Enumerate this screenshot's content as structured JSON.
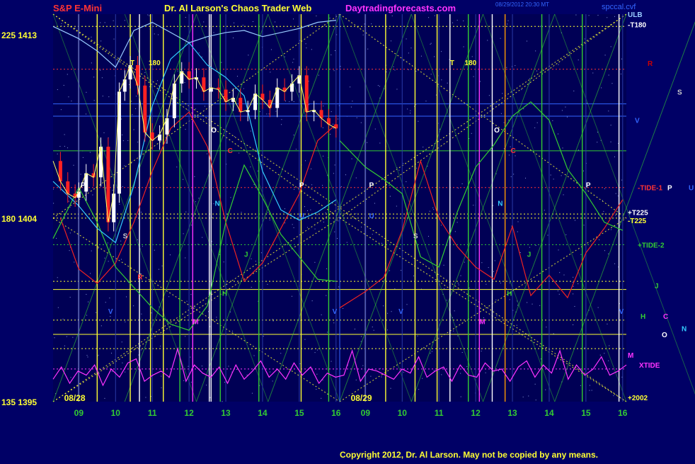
{
  "header": {
    "instrument": "S&P E-Mini",
    "title": "Dr. Al Larson's Chaos Trader Web",
    "site": "Daytradingforecasts.com",
    "timestamp": "08/29/2012 20:30 MT",
    "right_tag": "spccal.cvf"
  },
  "copyright": "Copyright 2012, Dr. Al Larson. May not be copied by any means.",
  "colors": {
    "background": "#000066",
    "plot_bg": "#000055",
    "price_up": "#ffffff",
    "price_down": "#ff2222",
    "grid_yellow": "#ffff33",
    "green_line": "#33cc33",
    "red_line": "#ee2222",
    "cyan_line": "#33ccff",
    "xtide": "#ff33ff"
  },
  "chart_data": {
    "type": "line",
    "title": "S&P E-Mini",
    "y_ticks": [
      {
        "label": "225 1413",
        "price": 1413
      },
      {
        "label": "180 1404",
        "price": 1404
      },
      {
        "label": "135 1395",
        "price": 1395
      }
    ],
    "ylim": [
      1395,
      1414
    ],
    "date_labels": [
      "08/28",
      "08/29"
    ],
    "x_ticks_day1": [
      "09",
      "10",
      "11",
      "12",
      "13",
      "14",
      "15",
      "16"
    ],
    "x_ticks_day2": [
      "09",
      "10",
      "11",
      "12",
      "13",
      "14",
      "15",
      "16"
    ],
    "x_range_hours": [
      8.3,
      16.1
    ],
    "price_series": {
      "name": "S&P E-Mini",
      "x": [
        8.3,
        8.5,
        8.7,
        8.9,
        9.0,
        9.2,
        9.4,
        9.6,
        9.8,
        9.95,
        10.1,
        10.25,
        10.4,
        10.6,
        10.8,
        11.0,
        11.2,
        11.4,
        11.6,
        11.8,
        12.0,
        12.2,
        12.4,
        12.6,
        12.8,
        13.0,
        13.2,
        13.4,
        13.6,
        13.8,
        14.0,
        14.2,
        14.4,
        14.6,
        14.8,
        15.0,
        15.2,
        15.4,
        15.6,
        15.8,
        16.0
      ],
      "y": [
        1406.8,
        1405.8,
        1405.2,
        1405.0,
        1405.3,
        1406.2,
        1406.0,
        1407.5,
        1403.8,
        1405.2,
        1410.2,
        1410.8,
        1411.5,
        1410.5,
        1408.2,
        1407.8,
        1408.1,
        1408.9,
        1410.6,
        1411.2,
        1410.8,
        1410.9,
        1410.2,
        1410.4,
        1410.3,
        1409.7,
        1409.9,
        1409.2,
        1409.3,
        1410.1,
        1409.8,
        1409.4,
        1410.4,
        1410.2,
        1410.6,
        1411.0,
        1409.2,
        1409.3,
        1408.9,
        1408.6,
        1408.4
      ]
    },
    "cycle_series": [
      {
        "name": "red",
        "color": "#ee2222",
        "x1": [
          8.5,
          9.0,
          9.5,
          10.0,
          10.5,
          11.0,
          11.5,
          12.0,
          12.5,
          13.0,
          13.5,
          14.0,
          14.5,
          15.0,
          15.5,
          16.0
        ],
        "y1": [
          1404.0,
          1401.5,
          1400.8,
          1401.8,
          1403.8,
          1406.3,
          1408.4,
          1409.2,
          1407.5,
          1403.8,
          1400.9,
          1401.8,
          1403.5,
          1405.2,
          1407.8,
          1408.6
        ],
        "x2": [
          8.3,
          9.0,
          9.5,
          10.0,
          10.5,
          11.0,
          11.5,
          12.0,
          12.5,
          13.0,
          13.5,
          14.0,
          14.5,
          15.0,
          15.5,
          16.0
        ],
        "y2": [
          1399.6,
          1400.4,
          1401.1,
          1403.4,
          1406.8,
          1404.0,
          1402.6,
          1401.6,
          1401.0,
          1403.6,
          1400.2,
          1401.2,
          1400.1,
          1402.3,
          1403.5,
          1404.9
        ]
      },
      {
        "name": "green",
        "color": "#33cc33",
        "x1": [
          8.3,
          9.0,
          9.5,
          10.0,
          10.5,
          11.0,
          11.5,
          12.0,
          12.5,
          13.0,
          13.5,
          14.0,
          14.5,
          15.0,
          15.5,
          16.0
        ],
        "y1": [
          1403.0,
          1405.5,
          1403.8,
          1401.6,
          1400.6,
          1399.6,
          1398.8,
          1398.5,
          1399.7,
          1403.8,
          1406.6,
          1405.0,
          1403.2,
          1402.1,
          1401.0,
          1400.9
        ],
        "x2": [
          8.3,
          9.0,
          9.5,
          10.0,
          10.5,
          11.0,
          11.5,
          12.0,
          12.5,
          13.0,
          13.5,
          14.0,
          14.5,
          15.0,
          15.5,
          16.0
        ],
        "y2": [
          1407.8,
          1406.5,
          1405.9,
          1405.2,
          1402.1,
          1401.6,
          1404.3,
          1406.5,
          1407.6,
          1409.0,
          1409.7,
          1408.8,
          1406.4,
          1405.2,
          1403.8,
          1403.4
        ]
      },
      {
        "name": "cyan",
        "color": "#33ccff",
        "x1": [
          8.3,
          9.0,
          9.5,
          10.0,
          10.5,
          11.0,
          11.5,
          12.0,
          12.5,
          13.0,
          13.5,
          14.0,
          14.5,
          15.0,
          15.5,
          16.0
        ],
        "y1": [
          1405.8,
          1404.6,
          1403.5,
          1402.8,
          1405.6,
          1409.5,
          1411.8,
          1412.6,
          1411.5,
          1410.9,
          1410.0,
          1406.3,
          1404.4,
          1403.9,
          1404.3,
          1404.9
        ],
        "x2": [],
        "y2": []
      },
      {
        "name": "lightblue",
        "color": "#99ccff",
        "x1": [
          8.3,
          9.0,
          9.5,
          10.0,
          10.5,
          11.0,
          11.5,
          12.0,
          12.5,
          13.0,
          13.5,
          14.0,
          14.5,
          15.0,
          15.5,
          16.0
        ],
        "y1": [
          1413.4,
          1412.8,
          1412.2,
          1411.4,
          1413.2,
          1413.6,
          1413.1,
          1412.6,
          1412.9,
          1413.1,
          1413.2,
          1412.9,
          1413.1,
          1413.3,
          1413.6,
          1413.7
        ],
        "x2": [],
        "y2": []
      }
    ],
    "vertical_lines": [
      {
        "h": 9.0,
        "color": "#ffffff"
      },
      {
        "h": 9.5,
        "color": "#ffff33"
      },
      {
        "h": 10.4,
        "color": "#ffff33"
      },
      {
        "h": 10.65,
        "color": "#ffffff"
      },
      {
        "h": 10.95,
        "color": "#ffff33"
      },
      {
        "h": 11.3,
        "color": "#ffff33"
      },
      {
        "h": 11.75,
        "color": "#33cc33"
      },
      {
        "h": 12.1,
        "color": "#ff33ff"
      },
      {
        "h": 12.55,
        "color": "#ffffff"
      },
      {
        "h": 12.6,
        "color": "#ffffff"
      },
      {
        "h": 12.85,
        "color": "#33cc33"
      },
      {
        "h": 13.9,
        "color": "#33cc33"
      },
      {
        "h": 15.05,
        "color": "#ffff33"
      },
      {
        "h": 15.8,
        "color": "#33cc33"
      }
    ],
    "vertical_lines_day2": [
      {
        "h": 9.0,
        "color": "#ffffff"
      },
      {
        "h": 9.55,
        "color": "#ffff33"
      },
      {
        "h": 10.35,
        "color": "#ffff33"
      },
      {
        "h": 10.95,
        "color": "#ffff33"
      },
      {
        "h": 11.3,
        "color": "#ffffff"
      },
      {
        "h": 11.8,
        "color": "#33cc33"
      },
      {
        "h": 12.1,
        "color": "#ff33ff"
      },
      {
        "h": 12.45,
        "color": "#ffffff"
      },
      {
        "h": 12.8,
        "color": "#ff9900"
      },
      {
        "h": 13.8,
        "color": "#33cc33"
      },
      {
        "h": 14.9,
        "color": "#33cc33"
      },
      {
        "h": 15.9,
        "color": "#ffffff"
      }
    ],
    "annotations": [
      {
        "t": "T",
        "day": 1,
        "h": 10.4,
        "p": 1411.5,
        "c": "#ffff33"
      },
      {
        "t": "180",
        "day": 1,
        "h": 10.9,
        "p": 1411.5,
        "c": "#ffff33"
      },
      {
        "t": "T",
        "day": 2,
        "h": 11.3,
        "p": 1411.5,
        "c": "#ffff33"
      },
      {
        "t": "180",
        "day": 2,
        "h": 11.7,
        "p": 1411.5,
        "c": "#ffff33"
      },
      {
        "t": "P",
        "day": 1,
        "h": 9.05,
        "p": 1405.5,
        "c": "#ffffff"
      },
      {
        "t": "P",
        "day": 1,
        "h": 15.0,
        "p": 1405.5,
        "c": "#ffffff"
      },
      {
        "t": "P",
        "day": 2,
        "h": 9.1,
        "p": 1405.5,
        "c": "#ffffff"
      },
      {
        "t": "P",
        "day": 2,
        "h": 15.0,
        "p": 1405.5,
        "c": "#ffffff"
      },
      {
        "t": "O",
        "day": 1,
        "h": 12.6,
        "p": 1408.2,
        "c": "#ffffff"
      },
      {
        "t": "O",
        "day": 2,
        "h": 12.5,
        "p": 1408.2,
        "c": "#ffffff"
      },
      {
        "t": "C",
        "day": 1,
        "h": 13.05,
        "p": 1407.2,
        "c": "#ff3333"
      },
      {
        "t": "C",
        "day": 2,
        "h": 12.95,
        "p": 1407.2,
        "c": "#ff3333"
      },
      {
        "t": "N",
        "day": 1,
        "h": 12.7,
        "p": 1404.6,
        "c": "#33ccff"
      },
      {
        "t": "N",
        "day": 2,
        "h": 12.6,
        "p": 1404.6,
        "c": "#33ccff"
      },
      {
        "t": "U",
        "day": 1,
        "h": 15.0,
        "p": 1404.0,
        "c": "#3366ff"
      },
      {
        "t": "U",
        "day": 2,
        "h": 9.1,
        "p": 1404.0,
        "c": "#3366ff"
      },
      {
        "t": "S",
        "day": 1,
        "h": 10.2,
        "p": 1403.0,
        "c": "#cccccc"
      },
      {
        "t": "S",
        "day": 2,
        "h": 10.3,
        "p": 1403.0,
        "c": "#cccccc"
      },
      {
        "t": "J",
        "day": 1,
        "h": 13.5,
        "p": 1402.1,
        "c": "#33cc33"
      },
      {
        "t": "J",
        "day": 2,
        "h": 13.4,
        "p": 1402.1,
        "c": "#33cc33"
      },
      {
        "t": "R",
        "day": 1,
        "h": 10.6,
        "p": 1401.0,
        "c": "#ff3333"
      },
      {
        "t": "H",
        "day": 1,
        "h": 12.9,
        "p": 1400.2,
        "c": "#33cc33"
      },
      {
        "t": "H",
        "day": 2,
        "h": 12.85,
        "p": 1400.2,
        "c": "#33cc33"
      },
      {
        "t": "M",
        "day": 1,
        "h": 12.1,
        "p": 1398.8,
        "c": "#ff33ff"
      },
      {
        "t": "M",
        "day": 2,
        "h": 12.1,
        "p": 1398.8,
        "c": "#ff33ff"
      },
      {
        "t": "V",
        "day": 1,
        "h": 9.8,
        "p": 1399.3,
        "c": "#3366ff"
      },
      {
        "t": "V",
        "day": 1,
        "h": 15.9,
        "p": 1399.3,
        "c": "#3366ff"
      },
      {
        "t": "V",
        "day": 2,
        "h": 9.9,
        "p": 1399.3,
        "c": "#3366ff"
      },
      {
        "t": "V",
        "day": 2,
        "h": 15.9,
        "p": 1399.3,
        "c": "#3366ff"
      }
    ],
    "right_labels": [
      {
        "t": "ULB",
        "p": 1414.0,
        "c": "#99ccff",
        "dx": 0
      },
      {
        "t": "-T180",
        "p": 1413.5,
        "c": "#ffffff",
        "dx": 0
      },
      {
        "t": "R",
        "p": 1411.6,
        "c": "#cc0000",
        "dx": 28
      },
      {
        "t": "S",
        "p": 1410.2,
        "c": "#cccccc",
        "dx": 70
      },
      {
        "t": "V",
        "p": 1408.8,
        "c": "#3366ff",
        "dx": 10
      },
      {
        "t": "-TIDE-1",
        "p": 1405.5,
        "c": "#ff3333",
        "dx": 14
      },
      {
        "t": "P",
        "p": 1405.5,
        "c": "#ffffff",
        "dx": 56
      },
      {
        "t": "U",
        "p": 1405.5,
        "c": "#3366ff",
        "dx": 86
      },
      {
        "t": "+T225",
        "p": 1404.3,
        "c": "#ffffff",
        "dx": 0
      },
      {
        "t": "-T225",
        "p": 1403.9,
        "c": "#ffff33",
        "dx": 0
      },
      {
        "t": "+TIDE-2",
        "p": 1402.7,
        "c": "#33cc33",
        "dx": 14
      },
      {
        "t": "J",
        "p": 1400.7,
        "c": "#33cc33",
        "dx": 38
      },
      {
        "t": "H",
        "p": 1399.2,
        "c": "#33cc33",
        "dx": 18
      },
      {
        "t": "C",
        "p": 1399.2,
        "c": "#ff33ff",
        "dx": 50
      },
      {
        "t": "N",
        "p": 1398.6,
        "c": "#33ccff",
        "dx": 76
      },
      {
        "t": "O",
        "p": 1398.3,
        "c": "#ffffff",
        "dx": 48
      },
      {
        "t": "M",
        "p": 1397.3,
        "c": "#ff33ff",
        "dx": 0
      },
      {
        "t": "XTIDE",
        "p": 1396.8,
        "c": "#ff33ff",
        "dx": 16
      },
      {
        "t": "+2002",
        "p": 1395.2,
        "c": "#ffff33",
        "dx": 0
      }
    ],
    "horizontal_levels": [
      {
        "p": 1413.4,
        "c": "#ffff33",
        "dash": true
      },
      {
        "p": 1411.3,
        "c": "#ff3333",
        "dash": true
      },
      {
        "p": 1409.6,
        "c": "#3366ff",
        "dash": false
      },
      {
        "p": 1409.0,
        "c": "#3366ff",
        "dash": false
      },
      {
        "p": 1407.3,
        "c": "#33cc33",
        "dash": false
      },
      {
        "p": 1405.5,
        "c": "#ff3333",
        "dash": true
      },
      {
        "p": 1404.2,
        "c": "#ffff33",
        "dash": true
      },
      {
        "p": 1404.0,
        "c": "#ffff33",
        "dash": true
      },
      {
        "p": 1402.7,
        "c": "#33cc33",
        "dash": true
      },
      {
        "p": 1400.9,
        "c": "#ffff33",
        "dash": true
      },
      {
        "p": 1400.5,
        "c": "#ffff33",
        "dash": false
      },
      {
        "p": 1399.0,
        "c": "#ffff33",
        "dash": true
      },
      {
        "p": 1398.3,
        "c": "#ffff33",
        "dash": false
      },
      {
        "p": 1397.6,
        "c": "#ffff33",
        "dash": true
      },
      {
        "p": 1396.6,
        "c": "#ff33ff",
        "dash": true
      }
    ],
    "xtide_series": {
      "name": "XTIDE",
      "values": [
        1396.1,
        1396.7,
        1395.9,
        1396.5,
        1396.3,
        1396.8,
        1395.8,
        1396.6,
        1396.2,
        1396.9,
        1397.1,
        1396.0,
        1396.3,
        1396.5,
        1396.2,
        1397.6,
        1396.0,
        1396.8,
        1396.4,
        1396.2,
        1396.7,
        1395.9,
        1396.8,
        1396.1,
        1396.5,
        1397.0,
        1396.2,
        1396.6,
        1396.1,
        1396.9,
        1396.3,
        1396.7,
        1395.9,
        1396.4,
        1396.2,
        1396.3,
        1397.5,
        1396.0,
        1396.6,
        1396.5,
        1396.3,
        1396.1,
        1396.6,
        1396.4,
        1397.2,
        1396.2,
        1396.5,
        1396.7,
        1396.0,
        1396.8,
        1396.3,
        1396.2,
        1396.9,
        1396.5,
        1396.6,
        1396.0,
        1396.7,
        1397.0,
        1396.2,
        1396.8,
        1396.4,
        1397.5,
        1396.1,
        1396.8,
        1396.3,
        1396.6,
        1397.2,
        1396.3,
        1396.5,
        1396.8
      ]
    }
  }
}
